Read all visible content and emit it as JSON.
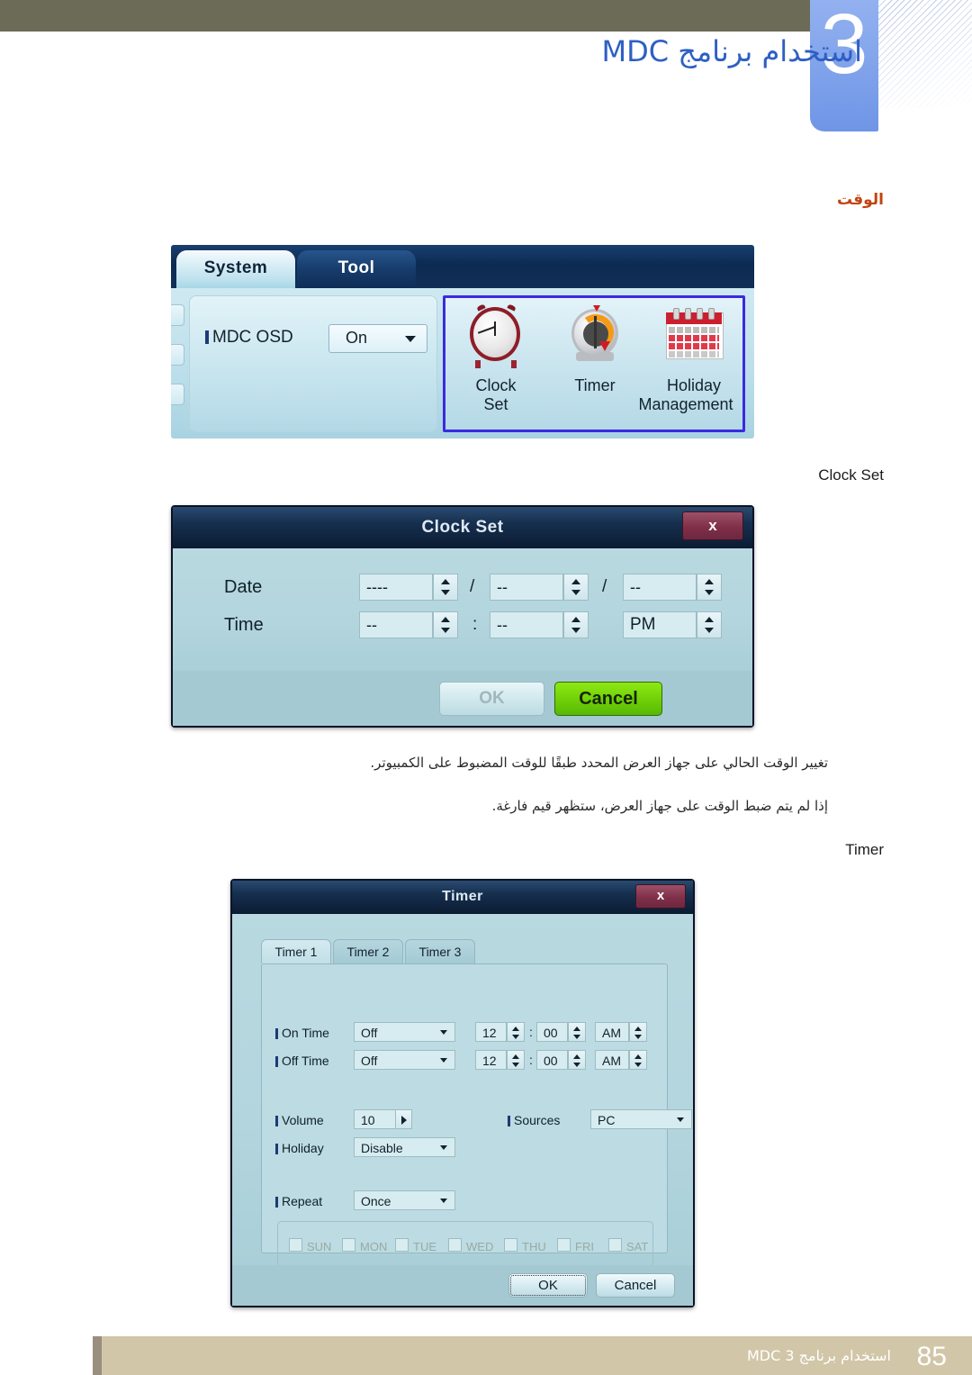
{
  "header": {
    "chapter_number": "3",
    "title": "استخدام برنامج MDC"
  },
  "section": {
    "title": "الوقت"
  },
  "osd_panel": {
    "tabs": [
      {
        "label": "System",
        "active": true
      },
      {
        "label": "Tool",
        "active": false
      }
    ],
    "setting": {
      "label": "MDC OSD",
      "value": "On"
    },
    "icon_buttons": [
      {
        "icon": "alarm-clock-icon",
        "line1": "Clock",
        "line2": "Set"
      },
      {
        "icon": "kitchen-timer-icon",
        "line1": "Timer",
        "line2": ""
      },
      {
        "icon": "calendar-icon",
        "line1": "Holiday",
        "line2": "Management"
      }
    ],
    "selection_color": "#3b2ae0"
  },
  "clock_set_caption": "Clock Set",
  "clock_set_dialog": {
    "title": "Clock Set",
    "close_label": "x",
    "rows": [
      {
        "label": "Date",
        "fields": [
          {
            "value": "----"
          },
          {
            "value": "--"
          },
          {
            "value": "--"
          }
        ],
        "separators": [
          "/",
          "/"
        ]
      },
      {
        "label": "Time",
        "fields": [
          {
            "value": "--"
          },
          {
            "value": "--"
          },
          {
            "value": "PM"
          }
        ],
        "separators": [
          ":",
          ""
        ]
      }
    ],
    "buttons": {
      "ok": "OK",
      "cancel": "Cancel",
      "ok_disabled": true,
      "cancel_color": "#6fcf07"
    }
  },
  "body_text": {
    "paragraph_1": "تغيير الوقت الحالي على جهاز العرض المحدد طبقًا للوقت المضبوط على الكمبيوتر.",
    "paragraph_2": "إذا لم يتم ضبط الوقت على جهاز العرض، ستظهر قيم فارغة."
  },
  "timer_caption": "Timer",
  "timer_dialog": {
    "title": "Timer",
    "close_label": "x",
    "tabs": [
      {
        "label": "Timer 1",
        "active": true
      },
      {
        "label": "Timer 2",
        "active": false
      },
      {
        "label": "Timer 3",
        "active": false
      }
    ],
    "fields": {
      "on_time": {
        "label": "On Time",
        "mode": "Off",
        "hour": "12",
        "minute": "00",
        "meridiem": "AM",
        "time_separator": ":"
      },
      "off_time": {
        "label": "Off Time",
        "mode": "Off",
        "hour": "12",
        "minute": "00",
        "meridiem": "AM",
        "time_separator": ":"
      },
      "volume": {
        "label": "Volume",
        "value": "10"
      },
      "sources": {
        "label": "Sources",
        "value": "PC"
      },
      "holiday": {
        "label": "Holiday",
        "value": "Disable"
      },
      "repeat": {
        "label": "Repeat",
        "value": "Once"
      }
    },
    "weekdays": [
      {
        "label": "SUN",
        "checked": false
      },
      {
        "label": "MON",
        "checked": false
      },
      {
        "label": "TUE",
        "checked": false
      },
      {
        "label": "WED",
        "checked": false
      },
      {
        "label": "THU",
        "checked": false
      },
      {
        "label": "FRI",
        "checked": false
      },
      {
        "label": "SAT",
        "checked": false
      }
    ],
    "buttons": {
      "ok": "OK",
      "cancel": "Cancel"
    }
  },
  "footer": {
    "page_number": "85",
    "text": "استخدام برنامج MDC 3"
  }
}
